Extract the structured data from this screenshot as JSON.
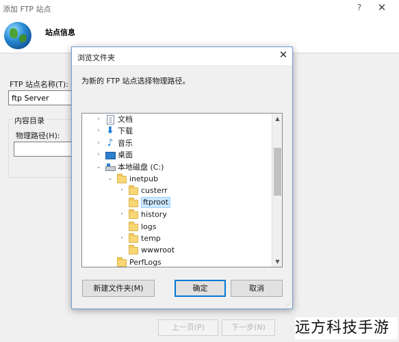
{
  "wizard": {
    "title": "添加 FTP 站点",
    "help_icon": "?",
    "close_icon": "✕",
    "heading": "站点信息",
    "site_name_label": "FTP 站点名称(T):",
    "site_name_value": "ftp Server",
    "content_dir_label": "内容目录",
    "physical_path_label": "物理路径(H):",
    "prev_label": "上一页(P)",
    "next_label": "下一步(N)"
  },
  "dialog": {
    "title": "浏览文件夹",
    "close_icon": "✕",
    "instruction": "为新的 FTP 站点选择物理路径。",
    "tree": [
      {
        "label": "文档",
        "icon": "document-icon",
        "depth": 1,
        "toggle": "›",
        "selected": false
      },
      {
        "label": "下载",
        "icon": "download-icon",
        "depth": 1,
        "toggle": "›",
        "selected": false
      },
      {
        "label": "音乐",
        "icon": "music-icon",
        "depth": 1,
        "toggle": "›",
        "selected": false
      },
      {
        "label": "桌面",
        "icon": "desktop-icon",
        "depth": 1,
        "toggle": "›",
        "selected": false
      },
      {
        "label": "本地磁盘 (C:)",
        "icon": "drive-icon",
        "depth": 1,
        "toggle": "⌄",
        "selected": false
      },
      {
        "label": "inetpub",
        "icon": "folder-icon",
        "depth": 2,
        "toggle": "⌄",
        "selected": false
      },
      {
        "label": "custerr",
        "icon": "folder-icon",
        "depth": 3,
        "toggle": "›",
        "selected": false
      },
      {
        "label": "ftproot",
        "icon": "folder-icon",
        "depth": 3,
        "toggle": "",
        "selected": true
      },
      {
        "label": "history",
        "icon": "folder-icon",
        "depth": 3,
        "toggle": "›",
        "selected": false
      },
      {
        "label": "logs",
        "icon": "folder-icon",
        "depth": 3,
        "toggle": "",
        "selected": false
      },
      {
        "label": "temp",
        "icon": "folder-icon",
        "depth": 3,
        "toggle": "›",
        "selected": false
      },
      {
        "label": "wwwroot",
        "icon": "folder-icon",
        "depth": 3,
        "toggle": "",
        "selected": false
      },
      {
        "label": "PerfLogs",
        "icon": "folder-icon",
        "depth": 2,
        "toggle": "",
        "selected": false
      }
    ],
    "new_folder_label": "新建文件夹(M)",
    "ok_label": "确定",
    "cancel_label": "取消"
  },
  "watermark": "远方科技手游"
}
